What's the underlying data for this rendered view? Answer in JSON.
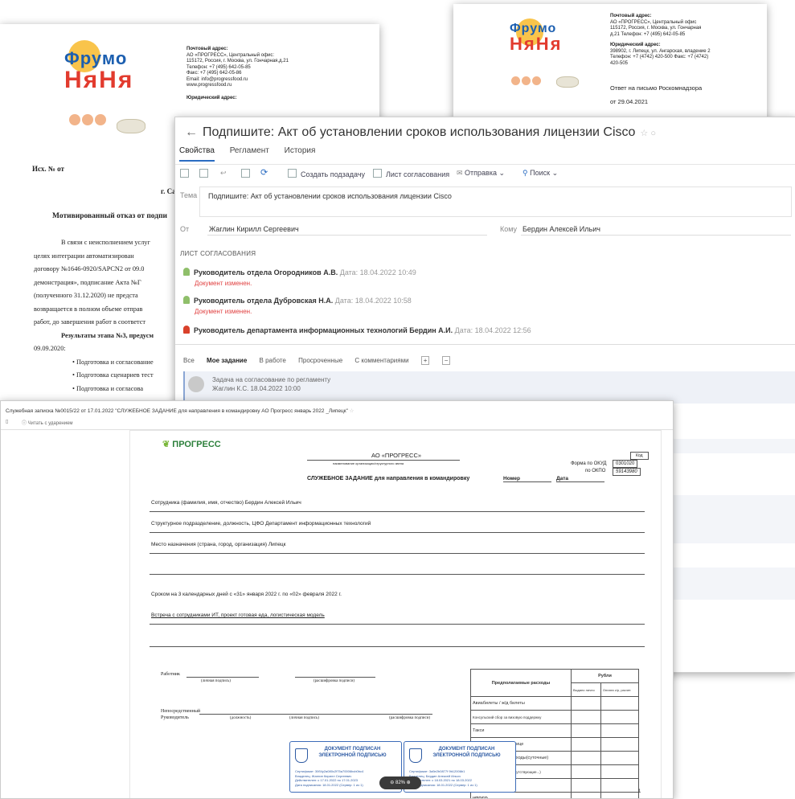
{
  "doc1": {
    "logo_line1": "Фрумо",
    "logo_line2": "НяНя",
    "postal_heading": "Почтовый адрес:",
    "postal_lines": [
      "АО «ПРОГРЕСС», Центральный офис:",
      "115172, Россия, г. Москва, ул. Гончарная,д.21",
      "Телефон: +7 (495) 642-05-85",
      "Факс: +7 (495) 642-05-86",
      "Email: info@progressfood.ru",
      "www.progressfood.ru"
    ],
    "legal_heading": "Юридический адрес:",
    "ref": "Исх. № от",
    "city": "г. Са",
    "title": "Мотивированный отказ от подпи",
    "para": [
      "В связи с неисполнением услуг",
      "целях интеграции автоматизирован",
      "договору №1646-0920/SAPCN2 от 09.0",
      "демонстрация», подписание Акта №Г",
      "(полученного 31.12.2020) не предста",
      "возвращается в полном объеме отправ",
      "работ, до завершения работ в соответст"
    ],
    "results": "Результаты этапа №3, предусм",
    "date": "09.09.2020:",
    "bullets": [
      "Подготовка и согласование",
      "Подготовка сценариев тест",
      "Подготовка и согласова"
    ]
  },
  "doc2": {
    "logo_line1": "Фрумо",
    "logo_line2": "НяНя",
    "postal_heading": "Почтовый адрес:",
    "postal_lines": [
      "АО «ПРОГРЕСС», Центральный офис",
      "115172, Россия, г. Москва, ул. Гончарная",
      "д.21 Телефон: +7 (495) 642-05-85"
    ],
    "legal_heading": "Юридический адрес:",
    "legal_lines": [
      "398902, г. Липецк, ул. Ангарская, владение 2",
      "Телефон: +7 (4742) 420-500 Факс: +7 (4742)",
      "420-505"
    ],
    "reply": "Ответ на письмо Роскомнадзора",
    "reply_date": "от 29.04.2021"
  },
  "window": {
    "title": "Подпишите: Акт об установлении сроков использования лицензии Cisco",
    "tabs": [
      "Свойства",
      "Регламент",
      "История"
    ],
    "toolbar": {
      "create_task": "Создать подзадачу",
      "approval_sheet": "Лист согласования",
      "send": "Отправка",
      "search": "Поиск"
    },
    "subject_label": "Тема",
    "subject_value": "Подпишите: Акт об установлении сроков использования лицензии Cisco",
    "from_label": "От",
    "from_value": "Жаглин Кирилл Сергеевич",
    "to_label": "Кому",
    "to_value": "Бердин Алексей Ильич",
    "approval_heading": "ЛИСТ СОГЛАСОВАНИЯ",
    "approvals": [
      {
        "role": "Руководитель отдела Огородников А.В.",
        "date": "Дата: 18.04.2022 10:49",
        "status": "Документ изменен."
      },
      {
        "role": "Руководитель отдела Дубровская Н.А.",
        "date": "Дата: 18.04.2022 10:58",
        "status": "Документ изменен."
      },
      {
        "role": "Руководитель департамента информационных технологий Бердин А.И.",
        "date": "Дата: 18.04.2022 12:56",
        "status": ""
      }
    ],
    "filters": [
      "Все",
      "Мое задание",
      "В работе",
      "Просроченные",
      "С комментариями"
    ],
    "task_title": "Задача на согласование по регламенту",
    "task_meta": "Жаглин К.С. 18.04.2022 10:00",
    "colors": {
      "accent": "#2a6cc2",
      "status_red": "#e04040"
    }
  },
  "doc3": {
    "title": "Служебная записка №0015/22 от 17.01.2022 \"СЛУЖЕБНОЕ ЗАДАНИЕ для направления в командировку АО Прогресс январь 2022 _Липецк\"",
    "toolbar_text": "Читать с ударением",
    "logo": "ПРОГРЕСС",
    "company": "АО «ПРОГРЕСС»",
    "company_caption": "наименование организации/структурного звена",
    "code_label": "Код",
    "okud_label": "Форма по ОКУД",
    "okud_value": "0301020",
    "okpo_label": "по ОКПО",
    "okpo_value": "59143980",
    "form_title": "СЛУЖЕБНОЕ ЗАДАНИЕ для направления в командировку",
    "number_label": "Номер",
    "date_label": "Дата",
    "employee": "Сотрудника (фамилия, имя, отчество) Бердин Алексей Ильич",
    "department": "Структурное подразделение, должность, ЦФО Департамент информационных технологий",
    "destination": "Место назначения (страна, город, организация) Липецк",
    "period": "Сроком на 3 календарных дней с «31» января 2022 г. по «02» февраля 2022 г.",
    "purpose": "Встреча с сотрудниками ИТ, проект готовая еда, логистическая модель",
    "worker_label": "Работник",
    "personal_sig": "(личная подпись)",
    "sig_decode": "(расшифровка подписи)",
    "head_label1": "Непосредственный",
    "head_label2": "Руководитель",
    "position": "(должность)",
    "personal_sig2": "(личная подпись)",
    "sig_decode2": "(расшифровка подписи)",
    "expenses_header": "Предполагаемые расходы",
    "rubles": "Рубли",
    "col_given": "Выдано лично",
    "col_paid": "Оплата с/р, расчет.",
    "expense_rows": [
      "Авиабилеты / ж/д билеты",
      "Консульский сбор за визовую поддержку",
      "Такси",
      "Проживание в гостинице",
      "Дополнительные расходы(суточные)",
      "Прочие (трансферы и сопутствующие...)",
      "Прочие (указать)",
      "ИТОГО"
    ],
    "stamp_title": "ДОКУМЕНТ ПОДПИСАН ЭЛЕКТРОННОЙ ПОДПИСЬЮ",
    "stamp2_title": "ДОКУМЕНТ ПОДПИСАН ЭЛЕКТРОННОЙ ПОДПИСЬЮ",
    "stamp_meta": [
      "Сертификат: 30б4у2а080c2f75a70006bcb0bc4",
      "Владелец: Жаглин Кирилл Сергеевич",
      "Действителен: с 17.01.2022 по 17.01.2023",
      "Дата подписания: 18.01.2022 (Сервер: 1 из 1)"
    ],
    "stamp2_meta": [
      "Сертификат: 3a5e2b0877f 9b12006b1",
      "Владелец: Бердин Алексей Ильич",
      "Действителен: с 18.03.2021 по 18.03.2022",
      "Дата подписания: 18.01.2022 (Сервер: 1 из 1)"
    ],
    "zoom": "82%",
    "page_num": "1"
  }
}
